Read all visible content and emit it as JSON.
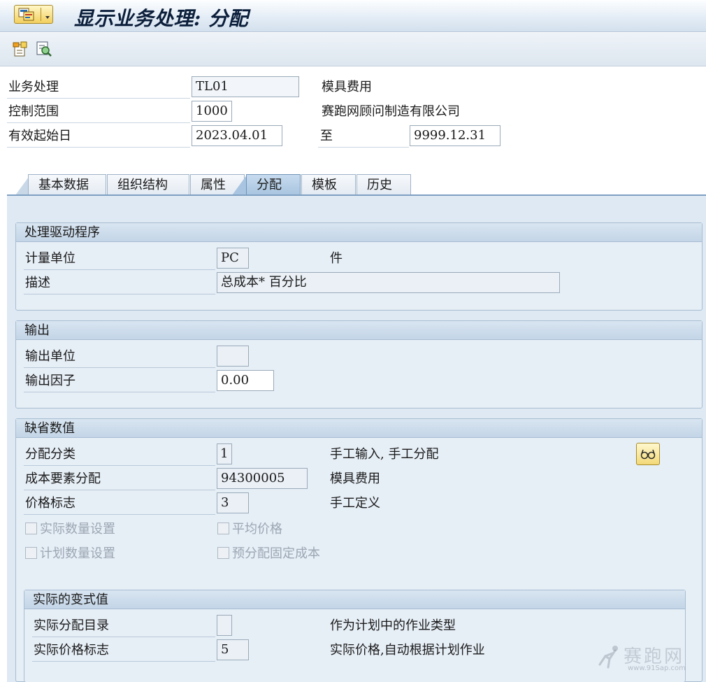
{
  "titlebar": {
    "title": "显示业务处理: 分配"
  },
  "toolbar": {
    "icons": [
      "change-document-icon",
      "display-search-icon"
    ]
  },
  "header": {
    "business_process_label": "业务处理",
    "business_process_value": "TL01",
    "business_process_desc": "模具费用",
    "controlling_area_label": "控制范围",
    "controlling_area_value": "1000",
    "controlling_area_desc": "赛跑网顾问制造有限公司",
    "valid_from_label": "有效起始日",
    "valid_from_value": "2023.04.01",
    "to_label": "至",
    "valid_to_value": "9999.12.31"
  },
  "tabs": [
    {
      "label": "基本数据",
      "active": false
    },
    {
      "label": "组织结构",
      "active": false
    },
    {
      "label": "属性",
      "active": false
    },
    {
      "label": "分配",
      "active": true
    },
    {
      "label": "模板",
      "active": false
    },
    {
      "label": "历史",
      "active": false
    }
  ],
  "driver_group": {
    "title": "处理驱动程序",
    "uom_label": "计量单位",
    "uom_value": "PC",
    "uom_desc": "件",
    "desc_label": "描述",
    "desc_value": "总成本* 百分比"
  },
  "output_group": {
    "title": "输出",
    "unit_label": "输出单位",
    "unit_value": "",
    "factor_label": "输出因子",
    "factor_value": "0.00"
  },
  "defaults_group": {
    "title": "缺省数值",
    "alloc_type_label": "分配分类",
    "alloc_type_value": "1",
    "alloc_type_desc": "手工输入, 手工分配",
    "cost_element_label": "成本要素分配",
    "cost_element_value": "94300005",
    "cost_element_desc": "模具费用",
    "price_ind_label": "价格标志",
    "price_ind_value": "3",
    "price_ind_desc": "手工定义",
    "cb_actual_qty": "实际数量设置",
    "cb_avg_price": "平均价格",
    "cb_plan_qty": "计划数量设置",
    "cb_prealloc": "预分配固定成本"
  },
  "variant_group": {
    "title": "实际的变式值",
    "actual_alloc_dir_label": "实际分配目录",
    "actual_alloc_dir_value": "",
    "actual_alloc_dir_desc": "作为计划中的作业类型",
    "actual_price_ind_label": "实际价格标志",
    "actual_price_ind_value": "5",
    "actual_price_ind_desc": "实际价格,自动根据计划作业"
  },
  "watermark": {
    "text": "赛跑网",
    "url": "www.91Sap.com"
  },
  "colors": {
    "accent": "#7ea0c3",
    "panel": "#dfe9f3",
    "button_yellow": "#f2d978"
  }
}
